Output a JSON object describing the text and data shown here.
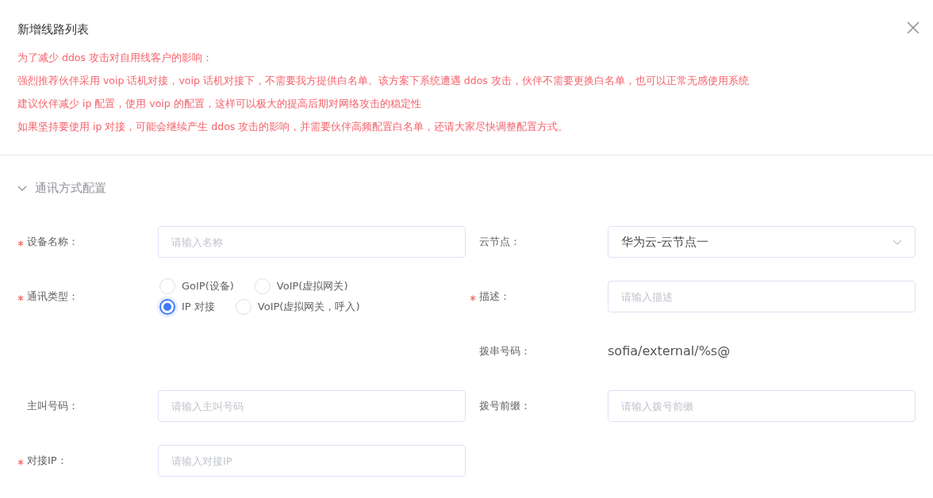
{
  "dialog": {
    "title": "新增线路列表"
  },
  "notice": [
    "为了减少 ddos 攻击对自用线客户的影响：",
    "强烈推荐伙伴采用 voip 话机对接，voip 话机对接下，不需要我方提供白名单。该方案下系统遭遇 ddos 攻击，伙伴不需要更换白名单，也可以正常无感使用系统",
    "建议伙伴减少 ip 配置，使用 voip 的配置，这样可以极大的提高后期对网络攻击的稳定性",
    "如果坚持要使用 ip 对接，可能会继续产生 ddos 攻击的影响，并需要伙伴高频配置白名单，还请大家尽快调整配置方式。"
  ],
  "section": {
    "title": "通讯方式配置",
    "expanded": true
  },
  "form_rows": [
    {
      "left": {
        "kind": "input",
        "label": "设备名称：",
        "required": true,
        "placeholder": "请输入名称"
      },
      "right": {
        "kind": "select",
        "label": "云节点：",
        "required": false,
        "value": "华为云-云节点一"
      }
    },
    {
      "left": {
        "kind": "radio",
        "label": "通讯类型：",
        "required": true,
        "options": [
          {
            "label": "GoIP(设备)",
            "selected": false
          },
          {
            "label": "VoIP(虚拟网关)",
            "selected": false
          },
          {
            "label": "IP 对接",
            "selected": true
          },
          {
            "label": "VoIP(虚拟网关，呼入)",
            "selected": false
          }
        ]
      },
      "right": {
        "kind": "input",
        "label": "描述：",
        "required": true,
        "placeholder": "请输入描述"
      }
    },
    {
      "right": {
        "kind": "text",
        "label": "拨串号码：",
        "required": false,
        "value": "sofia/external/%s@"
      }
    },
    {
      "left": {
        "kind": "input",
        "label": "主叫号码：",
        "required": false,
        "placeholder": "请输入主叫号码"
      },
      "right": {
        "kind": "input",
        "label": "拨号前缀：",
        "required": false,
        "placeholder": "请输入拨号前缀"
      }
    },
    {
      "left": {
        "kind": "input",
        "label": "对接IP：",
        "required": true,
        "placeholder": "请输入对接IP"
      }
    }
  ]
}
